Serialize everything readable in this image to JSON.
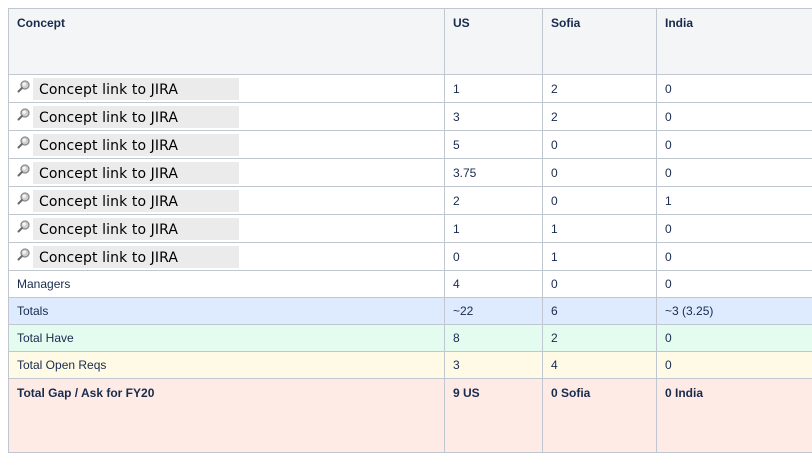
{
  "table": {
    "headers": [
      "Concept",
      "US",
      "Sofia",
      "India"
    ],
    "link_rows": [
      {
        "label": "Concept link to JIRA",
        "us": "1",
        "sofia": "2",
        "india": "0"
      },
      {
        "label": "Concept link to JIRA",
        "us": "3",
        "sofia": "2",
        "india": "0"
      },
      {
        "label": "Concept link to JIRA",
        "us": "5",
        "sofia": "0",
        "india": "0"
      },
      {
        "label": "Concept link to JIRA",
        "us": "3.75",
        "sofia": "0",
        "india": "0"
      },
      {
        "label": "Concept link to JIRA",
        "us": "2",
        "sofia": "0",
        "india": "1"
      },
      {
        "label": "Concept link to JIRA",
        "us": "1",
        "sofia": "1",
        "india": "0"
      },
      {
        "label": "Concept link to JIRA",
        "us": "0",
        "sofia": "1",
        "india": "0"
      }
    ],
    "managers": {
      "label": "Managers",
      "us": "4",
      "sofia": "0",
      "india": "0"
    },
    "totals": {
      "label": "Totals",
      "us": "~22",
      "sofia": "6",
      "india": "~3 (3.25)"
    },
    "total_have": {
      "label": "Total Have",
      "us": "8",
      "sofia": "2",
      "india": "0"
    },
    "total_open_reqs": {
      "label": "Total Open Reqs",
      "us": "3",
      "sofia": "4",
      "india": "0"
    },
    "total_gap": {
      "label": "Total Gap / Ask for FY20",
      "us": "9 US",
      "sofia": "0 Sofia",
      "india": "0 India"
    }
  },
  "icons": {
    "link_icon": "magnifier-icon"
  },
  "colors": {
    "header_bg": "#f4f5f7",
    "totals_bg": "#deebff",
    "have_bg": "#e3fcef",
    "open_reqs_bg": "#fffae6",
    "gap_bg": "#ffebe6",
    "link_bg": "#ebebeb",
    "border": "#c1c7d0"
  }
}
